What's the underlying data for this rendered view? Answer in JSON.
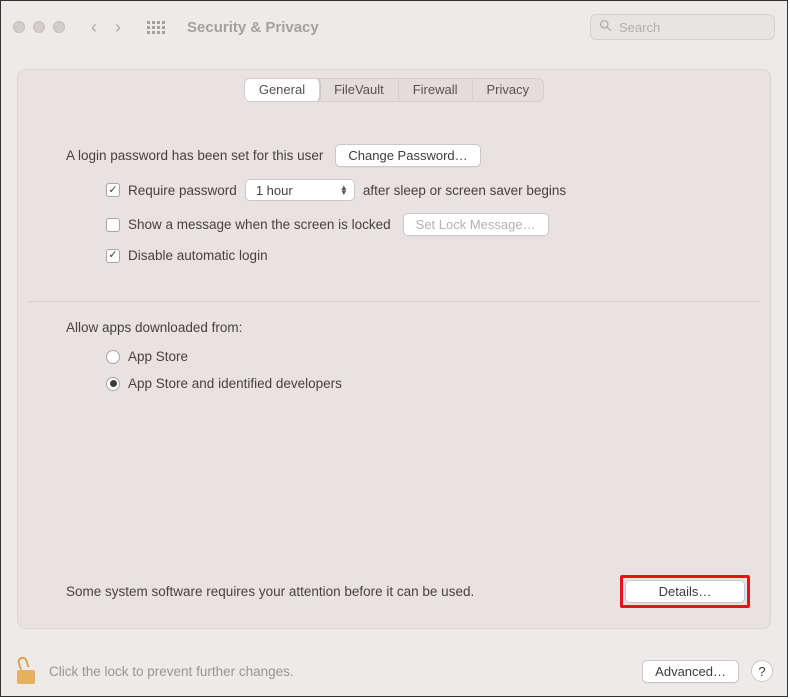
{
  "toolbar": {
    "title": "Security & Privacy",
    "search_placeholder": "Search"
  },
  "tabs": {
    "items": [
      "General",
      "FileVault",
      "Firewall",
      "Privacy"
    ],
    "selected_index": 0
  },
  "general": {
    "login_password_text": "A login password has been set for this user",
    "change_password_button": "Change Password…",
    "require_password": {
      "checked": true,
      "label_before": "Require password",
      "delay_value": "1 hour",
      "label_after": "after sleep or screen saver begins"
    },
    "show_message": {
      "checked": false,
      "label": "Show a message when the screen is locked",
      "set_button": "Set Lock Message…",
      "set_button_enabled": false
    },
    "disable_auto_login": {
      "checked": true,
      "label": "Disable automatic login"
    },
    "allow_apps": {
      "heading": "Allow apps downloaded from:",
      "options": [
        "App Store",
        "App Store and identified developers"
      ],
      "selected_index": 1
    },
    "attention": {
      "text": "Some system software requires your attention before it can be used.",
      "button": "Details…"
    }
  },
  "footer": {
    "lock_text": "Click the lock to prevent further changes.",
    "advanced_button": "Advanced…",
    "help_label": "?"
  }
}
